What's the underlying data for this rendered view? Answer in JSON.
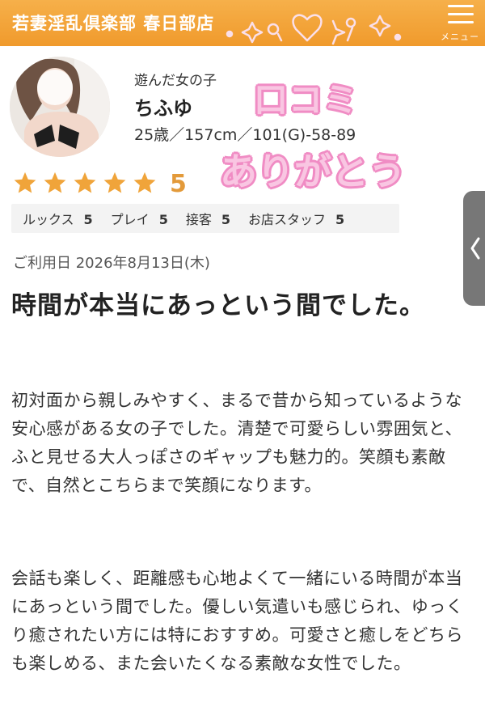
{
  "header": {
    "shop_name": "若妻淫乱倶楽部 春日部店",
    "menu_label": "メニュー",
    "icons": [
      "menu-icon",
      "sparkle-decoration"
    ],
    "colors": {
      "bar": "#f3a43b",
      "text": "#ffffff"
    }
  },
  "profile": {
    "caption": "遊んだ女の子",
    "name": "ちふゆ",
    "stats": "25歳／157cm／101(G)-58-89"
  },
  "badges": {
    "line1": "口コミ",
    "line2": "ありがとう",
    "color": "#f08cc4"
  },
  "rating": {
    "stars": 5,
    "max_stars": 5,
    "score": "5",
    "star_color": "#f0a43a",
    "sub_ratings": [
      {
        "label": "ルックス",
        "value": "5"
      },
      {
        "label": "プレイ",
        "value": "5"
      },
      {
        "label": "接客",
        "value": "5"
      },
      {
        "label": "お店スタッフ",
        "value": "5"
      }
    ]
  },
  "review": {
    "date": "ご利用日 2026年8月13日(木)",
    "title": "時間が本当にあっという間でした。",
    "paragraph1": "初対面から親しみやすく、まるで昔から知っているような安心感がある女の子でした。清楚で可愛らしい雰囲気と、ふと見せる大人っぽさのギャップも魅力的。笑顔も素敵で、自然とこちらまで笑顔になります。",
    "paragraph2": "会話も楽しく、距離感も心地よくて一緒にいる時間が本当にあっという間でした。優しい気遣いも感じられ、ゆっくり癒されたい方には特におすすめ。可愛さと癒しをどちらも楽しめる、また会いたくなる素敵な女性でした。"
  },
  "side_tab": {
    "icon": "chevron-left-icon"
  }
}
